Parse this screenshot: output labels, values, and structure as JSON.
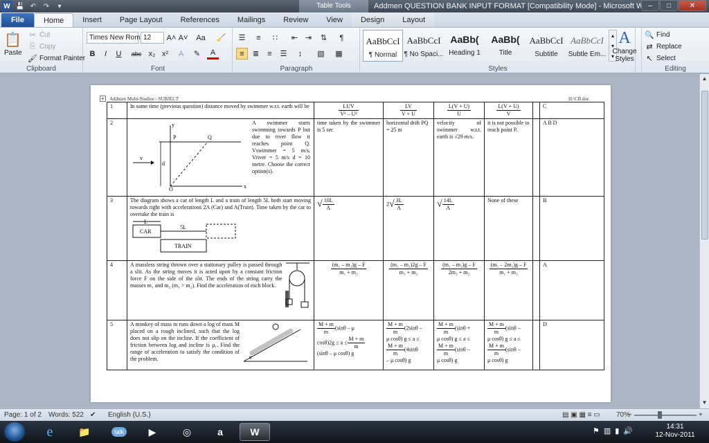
{
  "window": {
    "title": "Addmen QUESTION BANK INPUT FORMAT [Compatibility Mode] - Microsoft Word",
    "contextual_tab_header": "Table Tools",
    "app_icon": "W",
    "qat_icons": [
      "save-icon",
      "undo-icon",
      "redo-icon",
      "customize-icon"
    ],
    "controls": [
      "minimize",
      "restore",
      "close"
    ],
    "control_glyphs": [
      "–",
      "□",
      "✕"
    ]
  },
  "ribbon_tabs": [
    "File",
    "Home",
    "Insert",
    "Page Layout",
    "References",
    "Mailings",
    "Review",
    "View",
    "Design",
    "Layout"
  ],
  "clipboard": {
    "paste": "Paste",
    "cut": "Cut",
    "copy": "Copy",
    "format_painter": "Format Painter",
    "label": "Clipboard"
  },
  "font": {
    "family": "Times New Rom",
    "size": "12",
    "label": "Font",
    "buttons": [
      "B",
      "I",
      "U",
      "abc",
      "x₂",
      "x²"
    ],
    "aa": "Aa",
    "grow": "A˄",
    "shrink": "A˅"
  },
  "paragraph": {
    "label": "Paragraph",
    "pilcrow": "¶"
  },
  "styles": {
    "label": "Styles",
    "items": [
      {
        "sample": "AaBbCcI",
        "name": "¶ Normal"
      },
      {
        "sample": "AaBbCcI",
        "name": "¶ No Spaci..."
      },
      {
        "sample": "AaBb(",
        "name": "Heading 1"
      },
      {
        "sample": "AaBb(",
        "name": "Title"
      },
      {
        "sample": "AaBbCcI",
        "name": "Subtitle"
      },
      {
        "sample": "AaBbCcI",
        "name": "Subtle Em..."
      }
    ],
    "change_styles": "Change Styles",
    "change_styles_glyph": "A"
  },
  "editing": {
    "find": "Find",
    "replace": "Replace",
    "select": "Select",
    "label": "Editing"
  },
  "document": {
    "header_left": "Addmen Multi-Studios - SUBJECT",
    "header_right": "H:\\CB.doc",
    "rows": [
      {
        "num": "1",
        "question": "In same time (previous question) distance moved by swimmer w.r.t. earth will be",
        "opt1_num": "LUV",
        "opt1_den": "V² – U²",
        "opt2_num": "LV",
        "opt2_den": "V + U",
        "opt3_num": "L(V + U)",
        "opt3_den": "U",
        "opt4_num": "L(V + U)",
        "opt4_den": "V",
        "answer": "C"
      },
      {
        "num": "2",
        "question": "A swimmer starts swimming towards P but due to river flow it reaches point Q. Vswimmer = 5 m/s, Vriver = 5 m/s d = 10 metre. Choose the correct option(s).",
        "figure_labels": {
          "y": "y",
          "x": "x",
          "p": "P",
          "q": "Q",
          "o": "O",
          "v": "v",
          "d": "d"
        },
        "opt1": "time taken by the swimmer is 5 sec",
        "opt2": "horizontal drift PQ = 25 m",
        "opt3": "velocity of swimmer w.r.t. earth is √29 m/s.",
        "opt4": "it is not possible to reach point P.",
        "answer": "A B D"
      },
      {
        "num": "3",
        "question": "The diagram shows a car of length L and a train of length 5L both start moving towards right with accelerations 2A (Car) and A(Train). Time taken by the car to overtake the train is",
        "figure_labels": {
          "l": "L",
          "car": "CAR",
          "fivel": "5L",
          "train": "TRAIN"
        },
        "opt1_num": "10L",
        "opt1_den": "A",
        "opt2_pre": "2",
        "opt2_num": "3L",
        "opt2_den": "A",
        "opt3_num": "14L",
        "opt3_den": "A",
        "opt4": "None of these",
        "answer": "B"
      },
      {
        "num": "4",
        "question": "A massless string thrown over a stationary pulley is passed through a slit. As the string moves it is acted upon by a constant friction force F on the side of the slit. The ends of the string carry the masses m₁ and m₂ (m₁ > m₂). Find the acceleration of each block.",
        "figure_labels": {
          "m1": "m₁",
          "m2": "m₂"
        },
        "opt1_num": "(m₁ – m₂)g – F",
        "opt1_den": "m₁ + m₂",
        "opt2_num": "(m₁ – m₂)2g – F",
        "opt2_den": "m₁ + m₂",
        "opt3_num": "(m₁ – m₂)g – F",
        "opt3_den": "2m₁ + m₂",
        "opt4_num": "(m₁ – 2m₂)g – F",
        "opt4_den": "m₁ + m₂",
        "answer": "A"
      },
      {
        "num": "5",
        "question": "A monkey of mass m runs down a log of mass M placed on a rough inclined, such that the log does not slip on the incline. If the coefficient of friction between log and incline is μ₁. Find the range of acceleration to satisfy the condition of the problem.",
        "figure_labels": {
          "theta": "θ"
        },
        "frac_num": "M + m",
        "frac_den": "m",
        "opt1_a": "(sinθ – μ",
        "opt1_b": "cosθ)2g ≤ a ≤",
        "opt1_c": "(sinθ – μ cosθ) g",
        "opt2_a": "(2sinθ –",
        "opt2_b": "μ cosθ) g ≤ a ≤",
        "opt2_c": "(4sinθ",
        "opt2_d": "– μ cosθ) g",
        "opt3_a": "(sinθ +",
        "opt3_b": "μ cosθ) g ≤ a ≤",
        "opt3_c": "(sinθ –",
        "opt3_d": "μ cosθ) g",
        "opt4_a": "(sinθ –",
        "opt4_b": "μ cosθ) g ≤ a ≤",
        "opt4_c": "(sinθ –",
        "opt4_d": "μ cosθ) g",
        "answer": "D"
      }
    ]
  },
  "statusbar": {
    "page": "Page: 1 of 2",
    "words": "Words: 522",
    "language": "English (U.S.)",
    "zoom": "70%",
    "zoom_minus": "−",
    "zoom_plus": "+"
  },
  "taskbar": {
    "apps": [
      "start-orb",
      "internet-explorer",
      "windows-explorer",
      "google-talk",
      "media-player",
      "chrome",
      "avast",
      "microsoft-word"
    ],
    "talk_label": "talk",
    "clock_time": "14:31",
    "clock_date": "12-Nov-2011"
  }
}
